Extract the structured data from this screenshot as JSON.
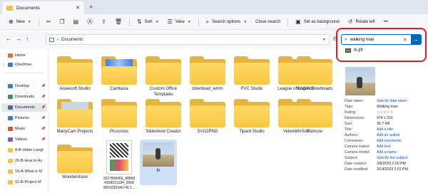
{
  "window": {
    "tab_title": "Documents",
    "tab_close": "✕",
    "tab_add": "+"
  },
  "toolbar": {
    "new_label": "New",
    "sort_label": "Sort",
    "view_label": "View",
    "search_options_label": "Search options",
    "close_search_label": "Close search",
    "set_background_label": "Set as background",
    "rotate_left_label": "Rotate left",
    "more_label": "•••"
  },
  "nav": {
    "back": "←",
    "forward": "→",
    "up": "↑",
    "refresh": "⟳"
  },
  "address": {
    "path": "Documents",
    "separator": "›"
  },
  "search": {
    "query": "walking man",
    "clear": "✕",
    "go": "→",
    "suggestion": "th.jfif"
  },
  "sidebar": {
    "items": [
      {
        "label": "Home",
        "icon": "home-icon",
        "color": "#e06c3c"
      },
      {
        "label": "OneDrive",
        "icon": "cloud-icon",
        "color": "#3a7bd5"
      },
      {
        "label": "Desktop",
        "icon": "desktop-icon",
        "color": "#3a7bd5"
      },
      {
        "label": "Downloads",
        "icon": "download-icon",
        "color": "#2b9a5a"
      },
      {
        "label": "Documents",
        "icon": "document-icon",
        "color": "#4f6d8f"
      },
      {
        "label": "Pictures",
        "icon": "picture-icon",
        "color": "#3a7bd5"
      },
      {
        "label": "Music",
        "icon": "music-icon",
        "color": "#e0513c"
      },
      {
        "label": "Videos",
        "icon": "video-icon",
        "color": "#8a4fd5"
      },
      {
        "label": "8-B-Video Lengt",
        "icon": "folder-icon",
        "color": "#f3c242"
      },
      {
        "label": "20-B-How to Ac",
        "icon": "folder-icon",
        "color": "#f3c242"
      },
      {
        "label": "19-A-What is M",
        "icon": "folder-icon",
        "color": "#f3c242"
      },
      {
        "label": "12-B-Project M",
        "icon": "folder-icon",
        "color": "#f3c242"
      }
    ]
  },
  "files": [
    {
      "label": "Aiseesoft Studio"
    },
    {
      "label": "Camtasia"
    },
    {
      "label": "Custom Office Templates"
    },
    {
      "label": "download_wmm"
    },
    {
      "label": "FVC Studio"
    },
    {
      "label": "League of Legends"
    },
    {
      "label": "MAGIX Downloads"
    },
    {
      "label": "ManyCam Projects"
    },
    {
      "label": "Picosmos"
    },
    {
      "label": "Slideshow Creator"
    },
    {
      "label": "SVG2PNG"
    },
    {
      "label": "Tipard Studio"
    },
    {
      "label": "VideoWinSoft"
    },
    {
      "label": "Vidmore"
    },
    {
      "label": "Wondershare"
    },
    {
      "label": "3327808466_88868 4358913184_5668 9654220346746 1..."
    },
    {
      "label": "th"
    }
  ],
  "details": {
    "rows": [
      {
        "key": "Date taken:",
        "value": "Specify date taken",
        "link": true
      },
      {
        "key": "Tags:",
        "value": "Walking man",
        "link": false
      },
      {
        "key": "Rating:",
        "value": "☆☆☆☆☆",
        "link": false
      },
      {
        "key": "Dimensions:",
        "value": "474 x 316",
        "link": false
      },
      {
        "key": "Size:",
        "value": "36.7 KB",
        "link": false
      },
      {
        "key": "Title:",
        "value": "Add a title",
        "link": true
      },
      {
        "key": "Authors:",
        "value": "Add an author",
        "link": true
      },
      {
        "key": "Comments:",
        "value": "Add comments",
        "link": true
      },
      {
        "key": "Camera maker:",
        "value": "Add text",
        "link": true
      },
      {
        "key": "Camera model:",
        "value": "Add a name",
        "link": true
      },
      {
        "key": "Subject:",
        "value": "Specify the subject",
        "link": true
      },
      {
        "key": "Date created:",
        "value": "3/8/2023 2:00 PM",
        "link": false
      },
      {
        "key": "Date modified:",
        "value": "3/14/2023 2:01 PM",
        "link": false
      }
    ]
  },
  "colors": {
    "accent": "#0067c0",
    "highlight": "#e31b23",
    "folder": "#f7c746"
  }
}
